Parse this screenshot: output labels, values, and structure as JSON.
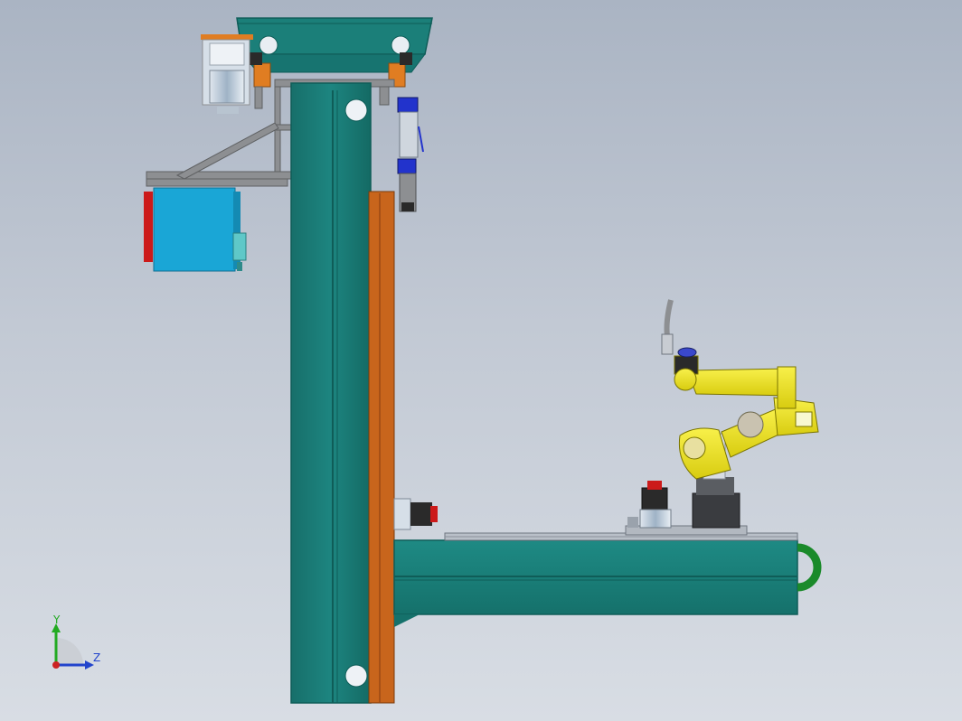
{
  "viewport": {
    "background_top": "#aab4c3",
    "background_bottom": "#d8dde4"
  },
  "colors": {
    "teal": "#1b7f79",
    "teal_dark": "#0f5d58",
    "orange": "#c8651c",
    "robot_yellow": "#f2e81f",
    "cabinet_blue": "#1aa6d6",
    "grey_frame": "#8d8f92",
    "motor_red": "#cc1a1a",
    "track_green": "#1a8a2a"
  },
  "triad": {
    "y_label": "Y",
    "z_label": "Z",
    "y_color": "#22aa22",
    "z_color": "#2244cc",
    "x_color": "#cc2222"
  },
  "icons": [
    "coordinate-triad-icon"
  ]
}
